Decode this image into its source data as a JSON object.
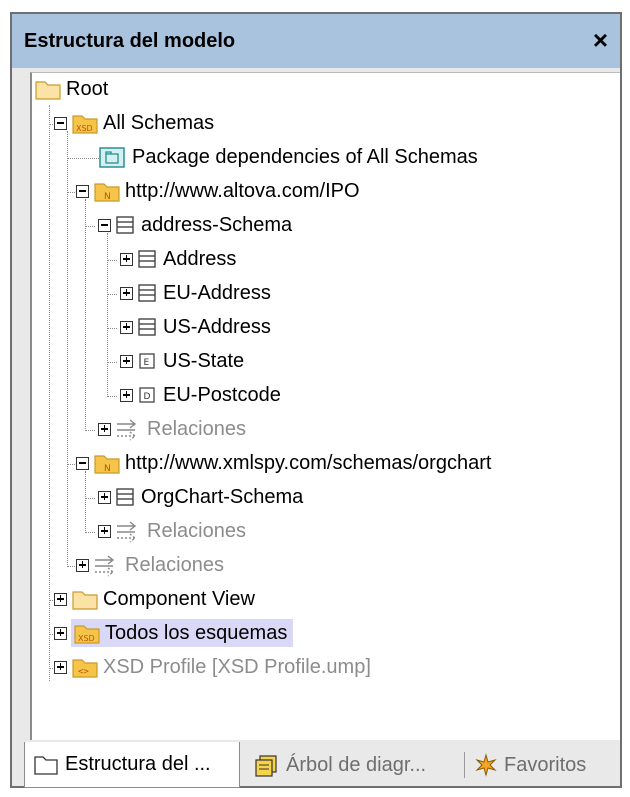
{
  "panel": {
    "title": "Estructura del modelo",
    "close_glyph": "×"
  },
  "tree": {
    "root": "Root",
    "all_schemas": "All Schemas",
    "pkg_deps": "Package dependencies of All Schemas",
    "ns_ipo": "http://www.altova.com/IPO",
    "address_schema": "address-Schema",
    "address": "Address",
    "eu_address": "EU-Address",
    "us_address": "US-Address",
    "us_state": "US-State",
    "eu_postcode": "EU-Postcode",
    "relaciones": "Relaciones",
    "ns_orgchart": "http://www.xmlspy.com/schemas/orgchart",
    "orgchart_schema": "OrgChart-Schema",
    "component_view": "Component View",
    "todos": "Todos los esquemas",
    "xsd_profile": "XSD Profile [XSD Profile.ump]"
  },
  "icon_text": {
    "xsd": "XSD",
    "n": "N",
    "e": "E",
    "d": "D",
    "code": "<>"
  },
  "tabs": {
    "estructura": "Estructura del ...",
    "arbol": "Árbol de diagr...",
    "favoritos": "Favoritos"
  },
  "colors": {
    "title_bar": "#a9c3de",
    "highlight": "#d9d9f7",
    "folder": "#fbe3a6",
    "xsd_folder": "#f7c44a"
  }
}
